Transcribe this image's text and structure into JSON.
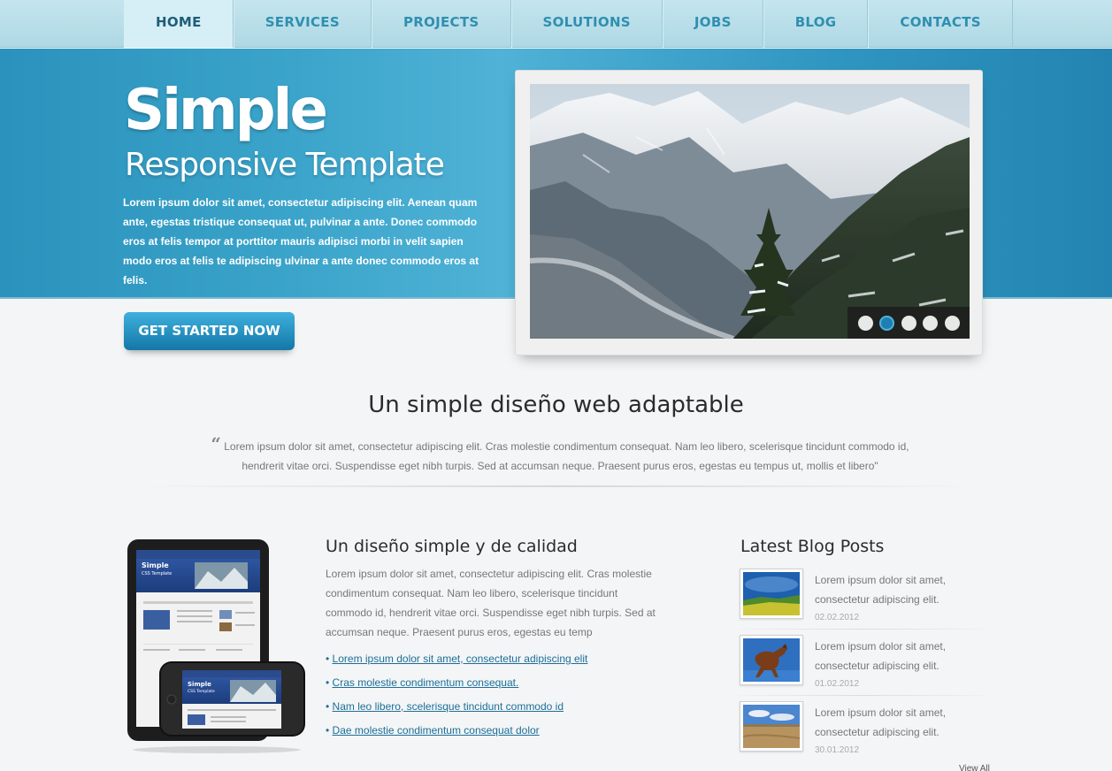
{
  "nav": {
    "items": [
      {
        "label": "HOME",
        "active": true
      },
      {
        "label": "SERVICES"
      },
      {
        "label": "PROJECTS"
      },
      {
        "label": "SOLUTIONS"
      },
      {
        "label": "JOBS"
      },
      {
        "label": "BLOG"
      },
      {
        "label": "CONTACTS"
      }
    ]
  },
  "hero": {
    "title": "Simple",
    "subtitle": "Responsive Template",
    "text": "Lorem ipsum dolor sit amet, consectetur adipiscing elit. Aenean quam ante, egestas tristique consequat ut, pulvinar a ante. Donec commodo eros at felis tempor at porttitor mauris adipisci morbi in velit sapien modo eros at felis te adipiscing ulvinar a ante donec commodo eros at felis.",
    "cta_label": "GET STARTED NOW"
  },
  "slider": {
    "dot_count": 5,
    "active_dot": 2
  },
  "intro": {
    "title": "Un simple diseño web adaptable",
    "quote_mark": "“",
    "quote": "Lorem ipsum dolor sit amet, consectetur adipiscing elit. Cras molestie condimentum consequat. Nam leo libero, scelerisque tincidunt commodo id, hendrerit vitae orci. Suspendisse eget nibh turpis. Sed at accumsan neque. Praesent purus eros, egestas eu tempus ut, mollis et libero\""
  },
  "device": {
    "screen_title": "Simple",
    "screen_subtitle": "CSS Template"
  },
  "quality": {
    "title": "Un diseño simple y de calidad",
    "text": "Lorem ipsum dolor sit amet, consectetur adipiscing elit. Cras molestie condimentum consequat. Nam leo libero, scelerisque tincidunt commodo id, hendrerit vitae orci. Suspendisse eget nibh turpis. Sed at accumsan neque. Praesent purus eros, egestas eu temp",
    "bullet": "•",
    "links": [
      "Lorem ipsum dolor sit amet, consectetur adipiscing elit",
      "Cras molestie condimentum consequat.",
      "Nam leo libero, scelerisque tincidunt commodo id",
      "Dae molestie condimentum consequat dolor"
    ]
  },
  "blog": {
    "title": "Latest Blog Posts",
    "posts": [
      {
        "text": "Lorem ipsum dolor sit amet, consectetur adipiscing elit.",
        "date": "02.02.2012",
        "thumb": "field-landscape-thumbnail"
      },
      {
        "text": "Lorem ipsum dolor sit amet, consectetur adipiscing elit.",
        "date": "01.02.2012",
        "thumb": "horse-thumbnail"
      },
      {
        "text": "Lorem ipsum dolor sit amet, consectetur adipiscing elit.",
        "date": "30.01.2012",
        "thumb": "desert-landscape-thumbnail"
      }
    ],
    "view_all": "View All"
  },
  "colors": {
    "nav_bg": "#b7dde8",
    "nav_text": "#2f8fb0",
    "hero_bg": "#2f9cc6",
    "cta_bg": "#1a84b8",
    "link": "#1c6f98"
  }
}
